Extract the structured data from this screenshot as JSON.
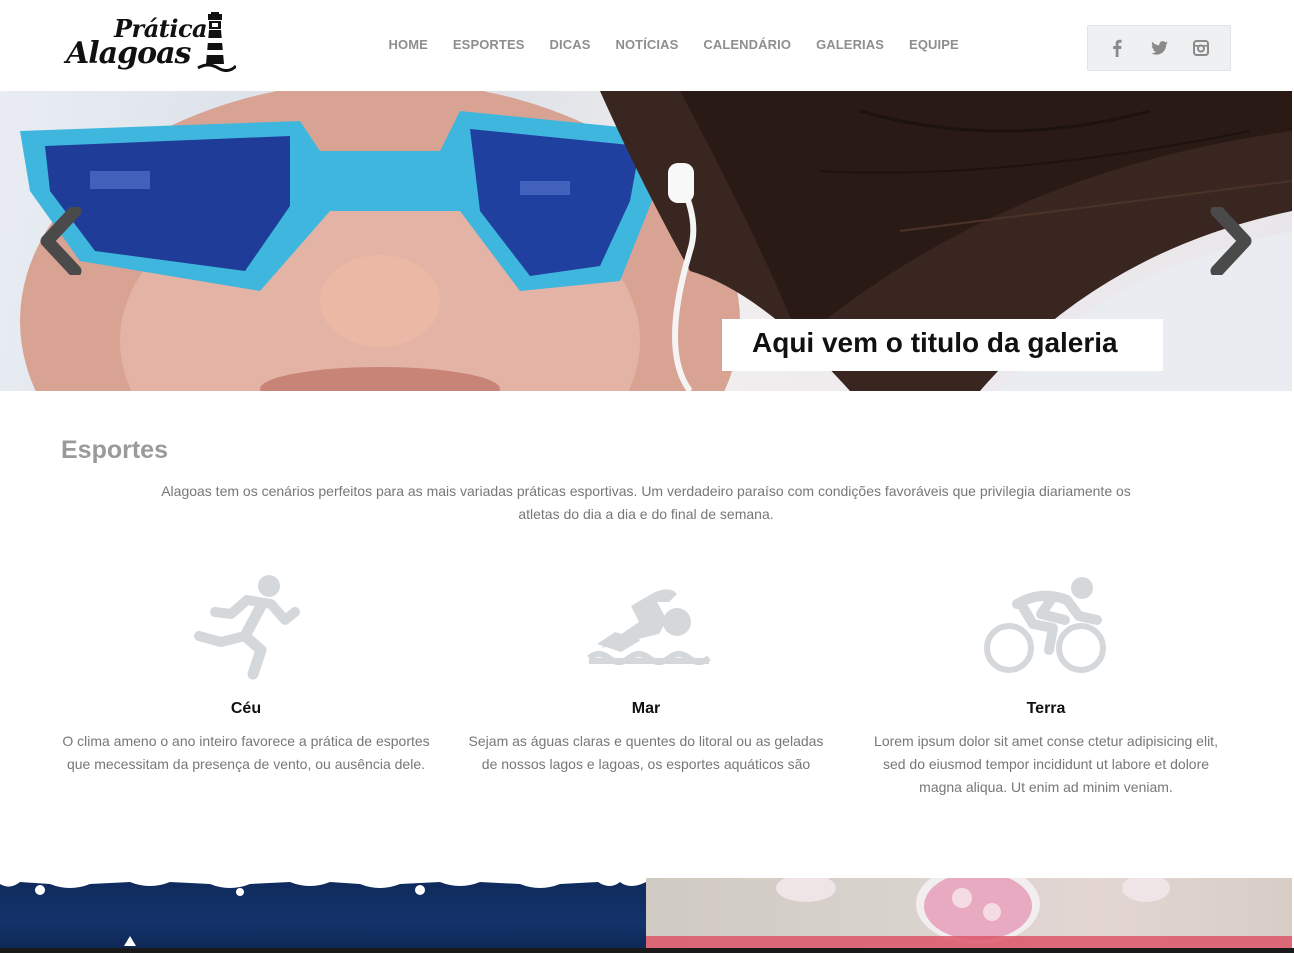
{
  "brand": {
    "line1": "Prática",
    "line2": "Alagoas"
  },
  "nav": [
    {
      "label": "HOME"
    },
    {
      "label": "ESPORTES"
    },
    {
      "label": "DICAS"
    },
    {
      "label": "NOTÍCIAS"
    },
    {
      "label": "CALENDÁRIO"
    },
    {
      "label": "GALERIAS"
    },
    {
      "label": "EQUIPE"
    }
  ],
  "social": [
    "facebook-icon",
    "twitter-icon",
    "instagram-icon"
  ],
  "slider": {
    "caption": "Aqui vem o titulo da galeria"
  },
  "esportes": {
    "title": "Esportes",
    "intro": "Alagoas tem os cenários perfeitos para as mais variadas práticas esportivas. Um verdadeiro paraíso com condições favoráveis que privilegia diariamente os atletas do dia a dia e do final de semana.",
    "items": [
      {
        "icon": "runner-icon",
        "title": "Céu",
        "text": "O clima ameno o ano inteiro favorece a prática de esportes que mecessitam da presença de vento, ou ausência dele."
      },
      {
        "icon": "swimmer-icon",
        "title": "Mar",
        "text": "Sejam as águas claras e quentes do litoral ou as geladas de nossos lagos e lagoas, os esportes aquáticos são"
      },
      {
        "icon": "cyclist-icon",
        "title": "Terra",
        "text": "Lorem ipsum dolor sit amet conse ctetur adipisicing elit, sed do eiusmod tempor incididunt ut labore et dolore magna aliqua. Ut enim ad minim veniam."
      }
    ]
  },
  "colors": {
    "nav_text": "#8e8e8e",
    "icon_gray": "#d5d8db",
    "social_bg": "#eef0f1",
    "accent_blue": "#3fb6dd"
  }
}
